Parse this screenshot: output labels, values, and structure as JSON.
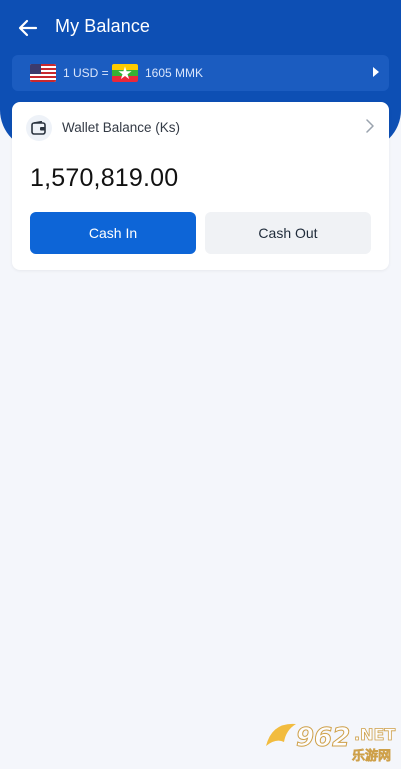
{
  "header": {
    "title": "My Balance"
  },
  "exchange_rate": {
    "from_label": "1 USD =",
    "to_label": "1605 MMK",
    "from_flag": "us-flag",
    "to_flag": "myanmar-flag"
  },
  "wallet": {
    "label": "Wallet Balance (Ks)",
    "amount": "1,570,819.00",
    "cash_in_label": "Cash In",
    "cash_out_label": "Cash Out"
  },
  "watermark": {
    "text": "962.NET",
    "subtext": "乐游网"
  },
  "colors": {
    "primary": "#0d4fb4",
    "button_primary": "#0d65d7",
    "background": "#f4f6fb"
  }
}
